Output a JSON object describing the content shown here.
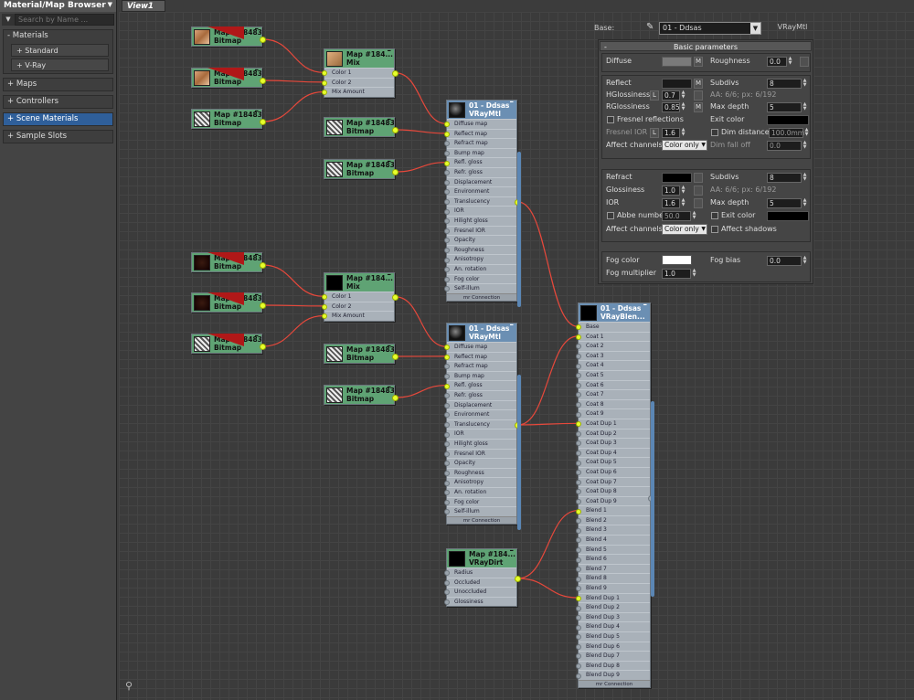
{
  "browser": {
    "title": "Material/Map Browser",
    "search_placeholder": "Search by Name ...",
    "groups": [
      {
        "label": "- Materials",
        "subs": [
          "+ Standard",
          "+ V-Ray"
        ]
      },
      {
        "label": "+ Maps"
      },
      {
        "label": "+ Controllers"
      },
      {
        "label": "+ Scene Materials",
        "selected": true
      },
      {
        "label": "+ Sample Slots"
      }
    ]
  },
  "view_tab": "View1",
  "nodes": {
    "bmp1": {
      "t1": "Map #184830...",
      "t2": "Bitmap"
    },
    "bmp2": {
      "t1": "Map #184830...",
      "t2": "Bitmap"
    },
    "bmp3": {
      "t1": "Map #184830...",
      "t2": "Bitmap"
    },
    "mix1": {
      "t1": "Map #184...",
      "t2": "Mix",
      "slots": [
        "Color 1",
        "Color 2",
        "Mix Amount"
      ]
    },
    "bmp4": {
      "t1": "Map #184830...",
      "t2": "Bitmap"
    },
    "bmp5": {
      "t1": "Map #184830...",
      "t2": "Bitmap"
    },
    "mtl1": {
      "t1": "01 - Ddsas",
      "t2": "VRayMtl"
    },
    "bmp6": {
      "t1": "Map #184830...",
      "t2": "Bitmap"
    },
    "bmp7": {
      "t1": "Map #184830...",
      "t2": "Bitmap"
    },
    "bmp8": {
      "t1": "Map #184830...",
      "t2": "Bitmap"
    },
    "mix2": {
      "t1": "Map #184...",
      "t2": "Mix",
      "slots": [
        "Color 1",
        "Color 2",
        "Mix Amount"
      ]
    },
    "bmp9": {
      "t1": "Map #184830...",
      "t2": "Bitmap"
    },
    "bmp10": {
      "t1": "Map #184830...",
      "t2": "Bitmap"
    },
    "mtl2": {
      "t1": "01 - Ddsas",
      "t2": "VRayMtl"
    },
    "dirt": {
      "t1": "Map #184...",
      "t2": "VRayDirt",
      "slots": [
        "Radius",
        "Occluded",
        "Unoccluded",
        "Glossiness"
      ]
    },
    "blend": {
      "t1": "01 - Ddsas",
      "t2": "VRayBlen..."
    }
  },
  "mtl_slots": [
    "Diffuse map",
    "Reflect map",
    "Refract map",
    "Bump map",
    "Refl. gloss",
    "Refr. gloss",
    "Displacement",
    "Environment",
    "Translucency",
    "IOR",
    "Hilight gloss",
    "Fresnel IOR",
    "Opacity",
    "Roughness",
    "Anisotropy",
    "An. rotation",
    "Fog color",
    "Self-illum"
  ],
  "blend_slots": [
    "Base",
    "Coat 1",
    "Coat 2",
    "Coat 3",
    "Coat 4",
    "Coat 5",
    "Coat 6",
    "Coat 7",
    "Coat 8",
    "Coat 9",
    "Coat Dup 1",
    "Coat Dup 2",
    "Coat Dup 3",
    "Coat Dup 4",
    "Coat Dup 5",
    "Coat Dup 6",
    "Coat Dup 7",
    "Coat Dup 8",
    "Coat Dup 9",
    "Blend 1",
    "Blend 2",
    "Blend 3",
    "Blend 4",
    "Blend 5",
    "Blend 6",
    "Blend 7",
    "Blend 8",
    "Blend 9",
    "Blend Dup 1",
    "Blend Dup 2",
    "Blend Dup 3",
    "Blend Dup 4",
    "Blend Dup 5",
    "Blend Dup 6",
    "Blend Dup 7",
    "Blend Dup 8",
    "Blend Dup 9"
  ],
  "mr_connection": "mr Connection",
  "params": {
    "base_label": "Base:",
    "material_name": "01 - Ddsas",
    "material_type": "VRayMtl",
    "rollout": "Basic parameters",
    "rollout_toggle": "-",
    "diffuse": "Diffuse",
    "m": "M",
    "roughness": "Roughness",
    "roughness_val": "0.0",
    "reflect": "Reflect",
    "subdivs": "Subdivs",
    "subdivs_val": "8",
    "hgloss": "HGlossiness",
    "l": "L",
    "hgloss_val": "0.7",
    "aa1": "AA: 6/6; px: 6/192",
    "rgloss": "RGlossiness",
    "rgloss_val": "0.85",
    "maxdepth": "Max depth",
    "maxdepth_val": "5",
    "fresnel": "Fresnel reflections",
    "exit_color": "Exit color",
    "fresnel_ior": "Fresnel IOR",
    "fresnel_ior_val": "1.6",
    "dim_distance": "Dim distance",
    "dim_distance_val": "100.0mm",
    "affect_channels": "Affect channels",
    "color_only": "Color only",
    "dim_falloff": "Dim fall off",
    "dim_falloff_val": "0.0",
    "refract": "Refract",
    "glossiness": "Glossiness",
    "glossiness_val": "1.0",
    "aa2": "AA: 6/6; px: 6/192",
    "ior": "IOR",
    "ior_val": "1.6",
    "abbe": "Abbe number",
    "abbe_val": "50.0",
    "affect_shadows": "Affect shadows",
    "fog_color": "Fog color",
    "fog_bias": "Fog bias",
    "fog_bias_val": "0.0",
    "fog_mult": "Fog multiplier",
    "fog_mult_val": "1.0"
  },
  "colors": {
    "map_header": "#5fa374",
    "mat_header": "#6b8fb3",
    "wire": "#e6483b",
    "socket_on": "#e6ff2c",
    "selection": "#2f5f9a"
  },
  "icons": [
    "chevron-down-icon",
    "eyedropper-icon",
    "binoculars-icon",
    "minimize-icon"
  ]
}
